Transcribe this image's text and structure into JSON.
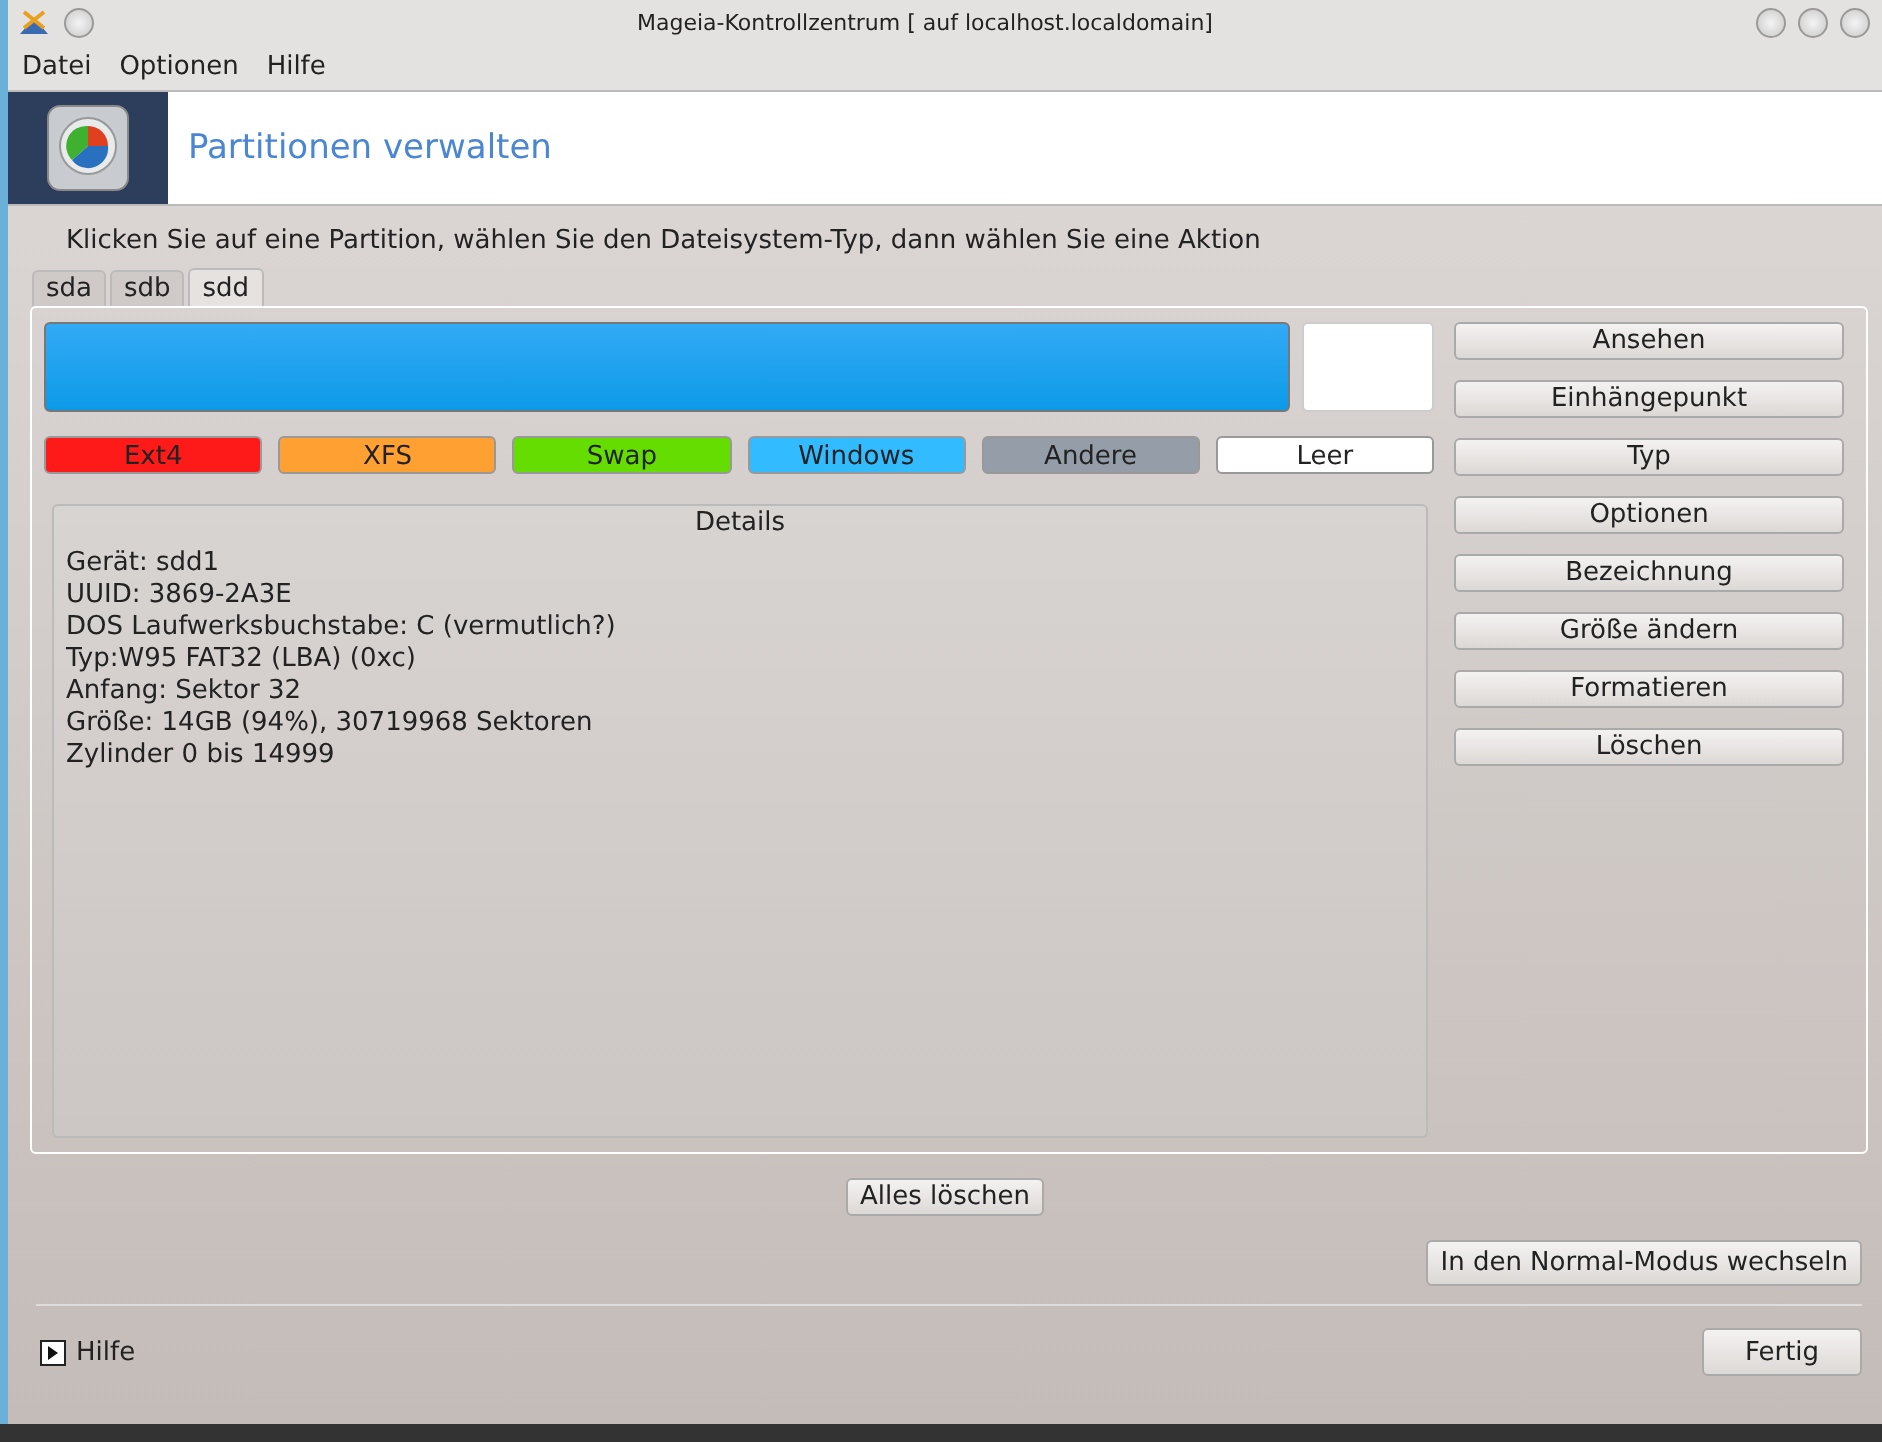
{
  "window": {
    "title": "Mageia-Kontrollzentrum  [ auf localhost.localdomain]"
  },
  "menu": [
    {
      "label": "Datei"
    },
    {
      "label": "Optionen"
    },
    {
      "label": "Hilfe"
    }
  ],
  "header": {
    "title": "Partitionen verwalten"
  },
  "instruction": "Klicken Sie auf eine Partition, wählen Sie den Dateisystem-Typ, dann wählen Sie eine Aktion",
  "tabs": [
    {
      "label": "sda",
      "selected": false
    },
    {
      "label": "sdb",
      "selected": false
    },
    {
      "label": "sdd",
      "selected": true
    }
  ],
  "disk": {
    "segments": [
      {
        "kind": "windows"
      },
      {
        "kind": "empty"
      }
    ]
  },
  "legend": [
    {
      "label": "Ext4",
      "color": "#ff1a1a"
    },
    {
      "label": "XFS",
      "color": "#ffa033"
    },
    {
      "label": "Swap",
      "color": "#66dd00"
    },
    {
      "label": "Windows",
      "color": "#33bbff"
    },
    {
      "label": "Andere",
      "color": "#959ea8"
    },
    {
      "label": "Leer",
      "color": "#ffffff"
    }
  ],
  "details": {
    "title": "Details",
    "lines": [
      "Gerät: sdd1",
      "UUID: 3869-2A3E",
      "DOS Laufwerksbuchstabe: C (vermutlich?)",
      "Typ:W95 FAT32 (LBA) (0xc)",
      "Anfang: Sektor 32",
      "Größe: 14GB (94%), 30719968 Sektoren",
      "Zylinder 0 bis 14999"
    ]
  },
  "actions": [
    "Ansehen",
    "Einhängepunkt",
    "Typ",
    "Optionen",
    "Bezeichnung",
    "Größe ändern",
    "Formatieren",
    "Löschen"
  ],
  "clear_all": "Alles löschen",
  "mode_button": "In den Normal-Modus wechseln",
  "help": {
    "label": "Hilfe",
    "expanded": false
  },
  "done_button": "Fertig"
}
